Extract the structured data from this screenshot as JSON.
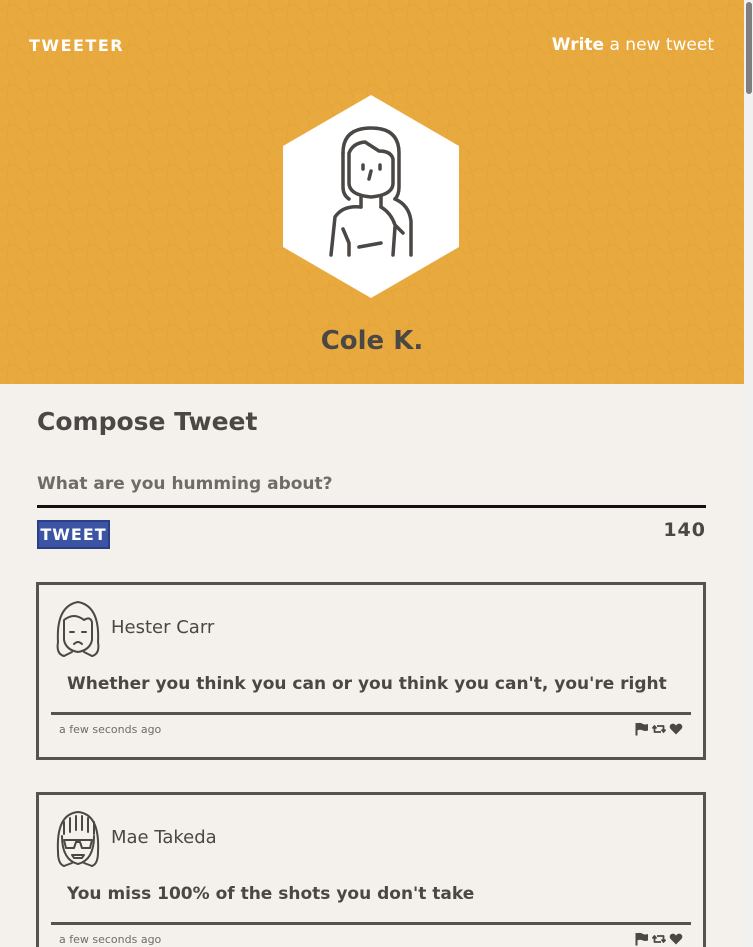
{
  "header": {
    "brand": "TWEETER",
    "write_link_bold": "Write",
    "write_link_rest": " a new tweet",
    "profile_name": "Cole K.",
    "background_color": "#e8a93e"
  },
  "compose": {
    "title": "Compose Tweet",
    "placeholder": "What are you humming about?",
    "button_label": "TWEET",
    "char_count": "140",
    "button_color": "#3b54a3"
  },
  "tweets": [
    {
      "author": "Hester Carr",
      "text": "Whether you think you can or you think you can't, you're right",
      "timestamp": "a few seconds ago",
      "avatar_icon": "woman-frown-avatar-icon",
      "actions": [
        "flag-icon",
        "retweet-icon",
        "heart-icon"
      ]
    },
    {
      "author": "Mae Takeda",
      "text": "You miss 100% of the shots you don't take",
      "timestamp": "a few seconds ago",
      "avatar_icon": "woman-sunglasses-avatar-icon",
      "actions": [
        "flag-icon",
        "retweet-icon",
        "heart-icon"
      ]
    }
  ]
}
